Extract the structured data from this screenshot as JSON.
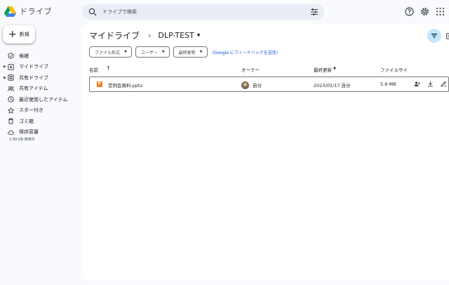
{
  "app": {
    "name": "ドライブ"
  },
  "search": {
    "placeholder": "ドライブで検索"
  },
  "new_button": {
    "label": "新規"
  },
  "nav": {
    "items": [
      {
        "label": "候補",
        "icon": "check-circle-icon",
        "expandable": false
      },
      {
        "label": "マイドライブ",
        "icon": "my-drive-icon",
        "expandable": true
      },
      {
        "label": "共有ドライブ",
        "icon": "shared-drive-icon",
        "expandable": true
      },
      {
        "label": "共有アイテム",
        "icon": "people-icon",
        "expandable": false
      },
      {
        "label": "最近使用したアイテム",
        "icon": "clock-icon",
        "expandable": false
      },
      {
        "label": "スター付き",
        "icon": "star-icon",
        "expandable": false
      },
      {
        "label": "ゴミ箱",
        "icon": "trash-icon",
        "expandable": false
      },
      {
        "label": "保存容量",
        "icon": "cloud-icon",
        "expandable": false
      }
    ],
    "storage_text": "1.99 GB 使用中"
  },
  "breadcrumb": {
    "root": "マイドライブ",
    "current": "DLP-TEST"
  },
  "filters": {
    "chips": [
      "ファイル形式",
      "ユーザー",
      "最終更新"
    ],
    "feedback_link": "(Google にフィードバックを送信)"
  },
  "table": {
    "headers": {
      "name": "名前",
      "owner": "オーナー",
      "modified": "最終更新",
      "size": "ファイルサイ"
    },
    "rows": [
      {
        "name": "定例会資料.pptx",
        "owner": "自分",
        "modified": "2023/05/17 自分",
        "size": "5.8 MB"
      }
    ]
  },
  "colors": {
    "accent": "#0b57d0",
    "filter_active_bg": "#c2e7ff",
    "pptx": "#fa7b17"
  }
}
